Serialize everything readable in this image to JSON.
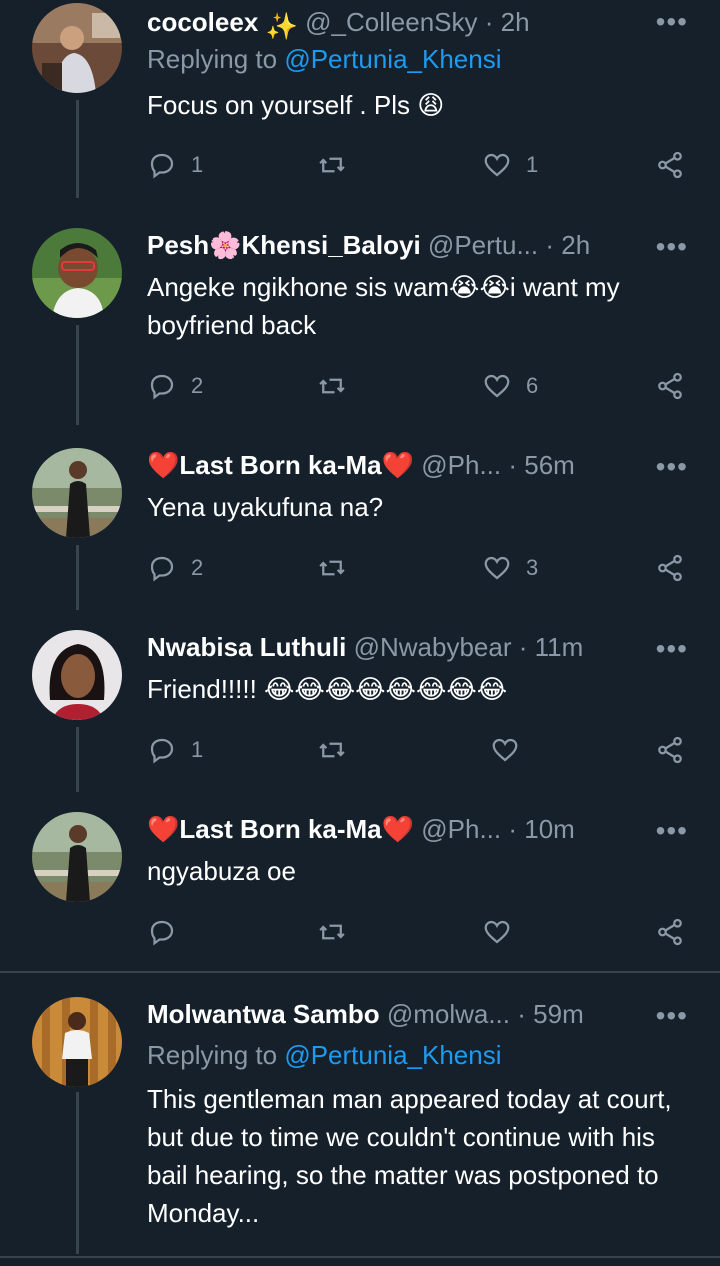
{
  "tweets": [
    {
      "name": "cocoleex",
      "name_suffix_emoji": "✨",
      "handle": "@_ColleenSky",
      "time": "2h",
      "reply_label": "Replying to",
      "reply_mention": "@Pertunia_Khensi",
      "text": "Focus on yourself . Pls 😩",
      "replies": "1",
      "retweets": "",
      "likes": "1"
    },
    {
      "name": "Pesh🌸Khensi_Baloyi",
      "handle": "@Pertu...",
      "time": "2h",
      "text": "Angeke ngikhone sis wam😭😭i want my boyfriend back",
      "replies": "2",
      "retweets": "",
      "likes": "6"
    },
    {
      "name": "❤️Last Born ka-Ma❤️",
      "handle": "@Ph...",
      "time": "56m",
      "text": "Yena uyakufuna na?",
      "replies": "2",
      "retweets": "",
      "likes": "3"
    },
    {
      "name": "Nwabisa Luthuli",
      "handle": "@Nwabybear",
      "time": "11m",
      "text": "Friend!!!!! 😂😂😂😂😂😂😂😂",
      "replies": "1",
      "retweets": "",
      "likes": ""
    },
    {
      "name": "❤️Last Born ka-Ma❤️",
      "handle": "@Ph...",
      "time": "10m",
      "text": "ngyabuza oe",
      "replies": "",
      "retweets": "",
      "likes": ""
    },
    {
      "name": "Molwantwa Sambo",
      "handle": "@molwa...",
      "time": "59m",
      "reply_label": "Replying to",
      "reply_mention": "@Pertunia_Khensi",
      "text": "This gentleman man appeared today at court, but due to time we couldn't continue with his bail hearing, so the matter was postponed to Monday..."
    }
  ],
  "separator": "·",
  "more_glyph": "•••",
  "icons": {
    "reply": "reply-icon",
    "retweet": "retweet-icon",
    "like": "heart-icon",
    "share": "share-icon",
    "more": "more-icon"
  },
  "colors": {
    "background": "#15202b",
    "text": "#ffffff",
    "secondary": "#8b98a5",
    "mention": "#1d9bf0",
    "line": "#38444d"
  }
}
